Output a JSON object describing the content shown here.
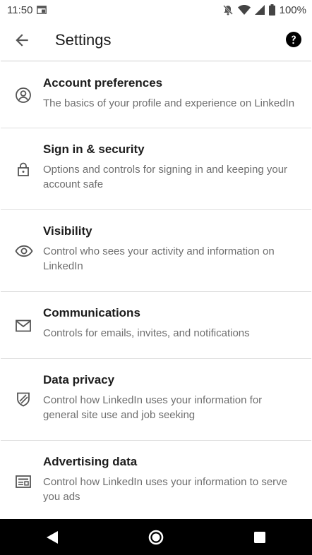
{
  "status_bar": {
    "time": "11:50",
    "battery": "100%",
    "icons": [
      "screenshot-icon",
      "mute-icon",
      "wifi-icon",
      "signal-icon",
      "battery-icon"
    ]
  },
  "app_bar": {
    "title": "Settings",
    "back_icon": "arrow-left-icon",
    "help_icon": "help-circle-icon"
  },
  "settings": [
    {
      "icon": "account-icon",
      "title": "Account preferences",
      "description": "The basics of your profile and experience on LinkedIn"
    },
    {
      "icon": "lock-icon",
      "title": "Sign in & security",
      "description": "Options and controls for signing in and keeping your account safe"
    },
    {
      "icon": "eye-icon",
      "title": "Visibility",
      "description": "Control who sees your activity and information on LinkedIn"
    },
    {
      "icon": "envelope-icon",
      "title": "Communications",
      "description": "Controls for emails, invites, and notifications"
    },
    {
      "icon": "shield-icon",
      "title": "Data privacy",
      "description": "Control how LinkedIn uses your information for general site use and job seeking"
    },
    {
      "icon": "ad-icon",
      "title": "Advertising data",
      "description": "Control how LinkedIn uses your information to serve you ads"
    }
  ],
  "nav_bar": {
    "buttons": [
      "back-triangle-icon",
      "home-circle-icon",
      "recents-square-icon"
    ]
  },
  "colors": {
    "background": "#ffffff",
    "heading": "#1c1c1c",
    "description": "#6e6e6e",
    "divider": "#dedede",
    "nav_bar": "#000000"
  }
}
